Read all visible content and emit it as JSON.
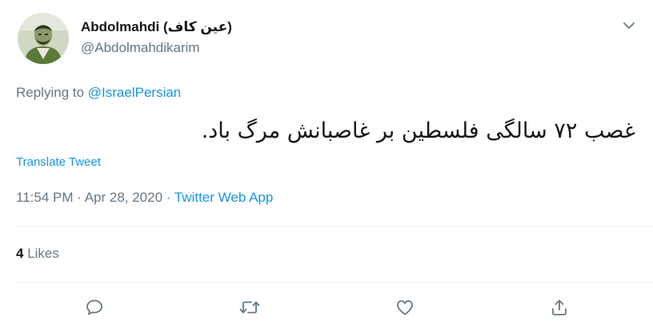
{
  "author": {
    "display_name": "Abdolmahdi (عین کاف)",
    "handle": "@Abdolmahdikarim"
  },
  "reply": {
    "prefix": "Replying to ",
    "to": "@IsraelPersian"
  },
  "tweet": {
    "text": "غصب ۷۲ سالگی فلسطین بر غاصبانش مرگ باد.",
    "translate_label": "Translate Tweet"
  },
  "meta": {
    "time": "11:54 PM",
    "separator": " · ",
    "date": "Apr 28, 2020",
    "source": "Twitter Web App"
  },
  "stats": {
    "likes_count": "4",
    "likes_label": " Likes"
  },
  "icons": {
    "caret": "chevron-down-icon",
    "reply": "reply-icon",
    "retweet": "retweet-icon",
    "like": "heart-icon",
    "share": "share-icon"
  },
  "colors": {
    "link": "#1b95e0",
    "secondary": "#657786",
    "primary": "#14171a",
    "divider": "#e6ecf0"
  }
}
